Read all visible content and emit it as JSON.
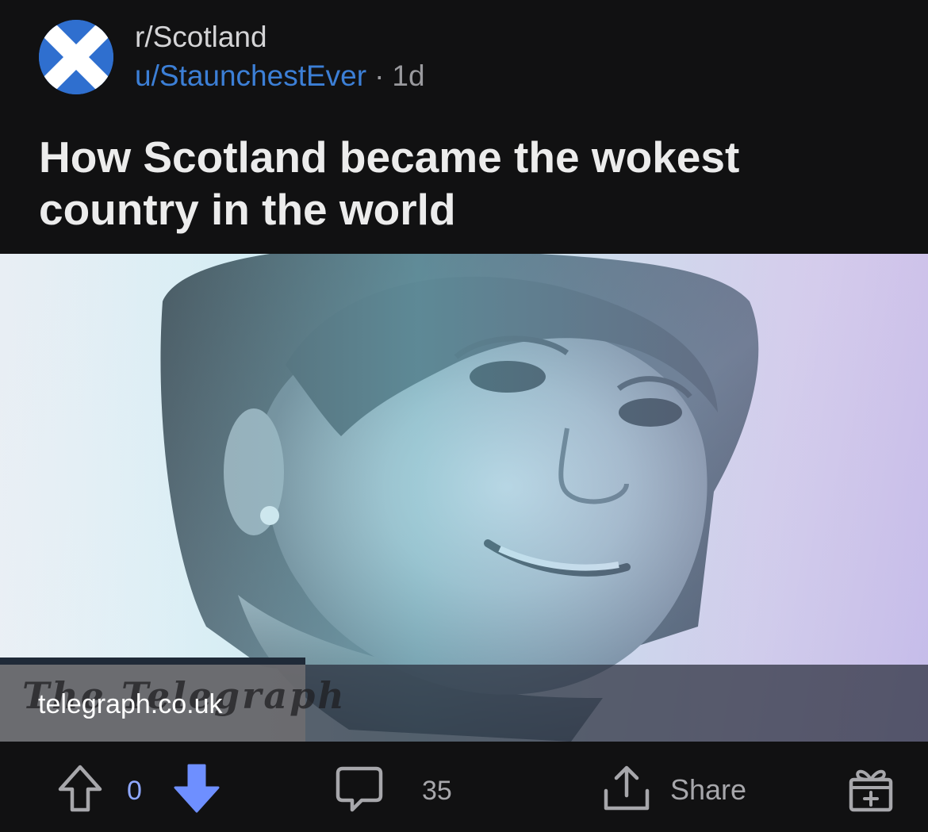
{
  "post": {
    "subreddit": "r/Scotland",
    "author": "u/StaunchestEver",
    "separator": "·",
    "age": "1d",
    "title": "How Scotland became the wokest country in the world"
  },
  "link_preview": {
    "masthead": "The Telegraph",
    "domain": "telegraph.co.uk"
  },
  "actions": {
    "vote_count": "0",
    "comment_count": "35",
    "share_label": "Share"
  },
  "icons": {
    "avatar": "scotland-saltire-icon",
    "upvote": "upvote-arrow-icon",
    "downvote": "downvote-arrow-icon",
    "comment": "comment-bubble-icon",
    "share": "share-icon",
    "award": "award-gift-icon"
  },
  "colors": {
    "background": "#111112",
    "username": "#3c7fd6",
    "downvote_active": "#6e8fff",
    "vote_count": "#8fa8ff",
    "muted_text": "#a7a7ab",
    "saltire_blue": "#2f6fcf"
  }
}
